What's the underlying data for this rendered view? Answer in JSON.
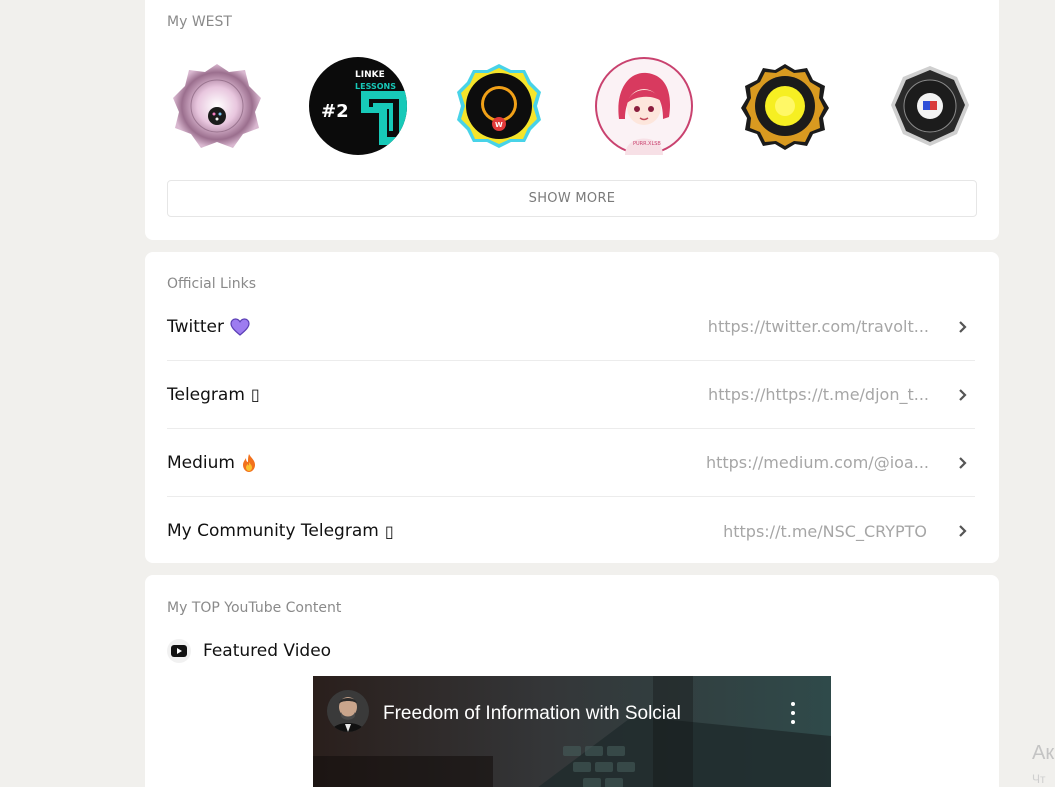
{
  "west": {
    "title": "My WEST",
    "badges": [
      {
        "icon": "pink-sparkle-badge"
      },
      {
        "icon": "linke-lessons-badge"
      },
      {
        "icon": "ftx-debacle-badge"
      },
      {
        "icon": "anime-girl-badge"
      },
      {
        "icon": "shootworld-nft-badge"
      },
      {
        "icon": "event-judge-story-badge"
      }
    ],
    "show_more_label": "SHOW MORE"
  },
  "links": {
    "title": "Official Links",
    "items": [
      {
        "label": "Twitter",
        "emoji": "💜",
        "url": "https://twitter.com/travolt..."
      },
      {
        "label": "Telegram",
        "emoji": "▯",
        "url": "https://https://t.me/djon_t..."
      },
      {
        "label": "Medium",
        "emoji": "🔥",
        "url": "https://medium.com/@ioa..."
      },
      {
        "label": "My Community Telegram",
        "emoji": "▯",
        "url": "https://t.me/NSC_CRYPTO"
      }
    ]
  },
  "youtube": {
    "title": "My TOP YouTube Content",
    "featured_label": "Featured Video",
    "video_title": "Freedom of Information with Solcial"
  },
  "corner": {
    "text": "Ак",
    "sub": "Чт"
  },
  "colors": {
    "page_bg": "#f1f0ed",
    "card_bg": "#ffffff",
    "muted_text": "#8a8a8a",
    "url_text": "#a6a6a6"
  }
}
